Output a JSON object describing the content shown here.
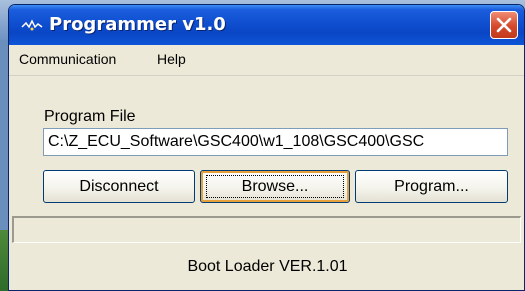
{
  "window": {
    "title": "Programmer v1.0",
    "app_icon": "signal-icon",
    "close_icon": "close-icon"
  },
  "menu": [
    {
      "label": "Communication"
    },
    {
      "label": "Help"
    }
  ],
  "program_file": {
    "label": "Program File",
    "value": "C:\\Z_ECU_Software\\GSC400\\w1_108\\GSC400\\GSC"
  },
  "buttons": {
    "disconnect": "Disconnect",
    "browse": "Browse...",
    "program": "Program..."
  },
  "progress": {
    "value": 0
  },
  "status": "Boot Loader VER.1.01",
  "colors": {
    "titlebar": "#0a46c5",
    "window_bg": "#ece9d8",
    "close_button": "#d5492c"
  }
}
